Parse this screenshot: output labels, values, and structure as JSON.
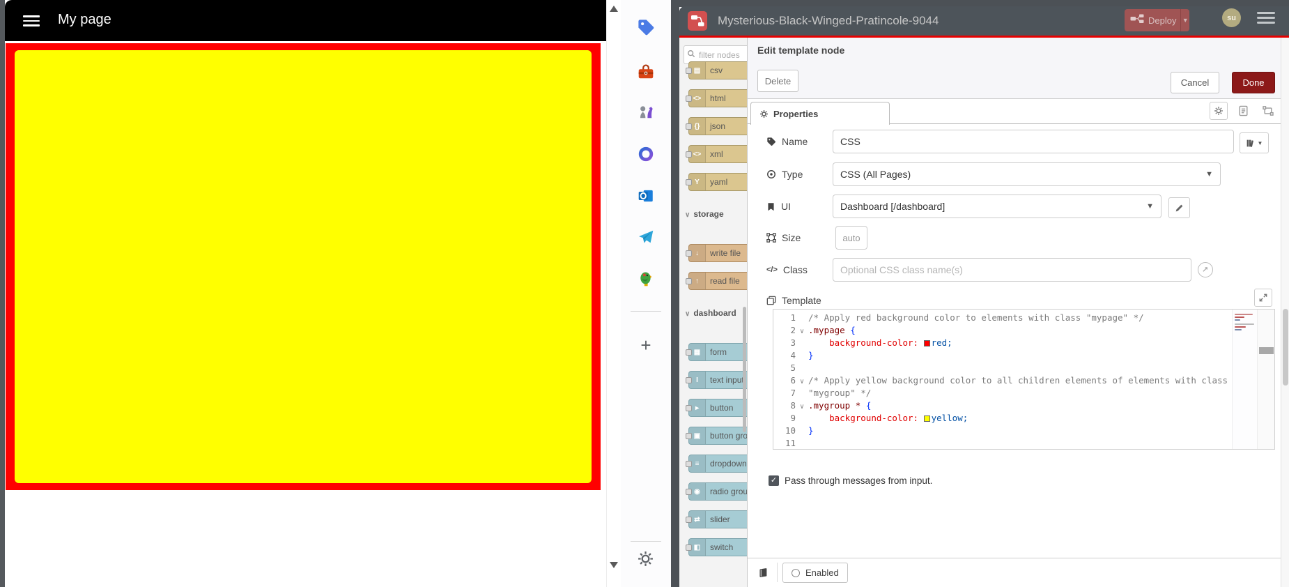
{
  "dashboard_page": {
    "title": "My page",
    "colors": {
      "header_bg": "#000000",
      "mypage_red": "#ff0000",
      "mygroup_yellow": "#ffff00"
    }
  },
  "edge_sidebar": {
    "icons": [
      "tag",
      "toolbox",
      "chess",
      "loop",
      "outlook",
      "telegram",
      "parrot"
    ],
    "plus": "+"
  },
  "node_red": {
    "header": {
      "title": "Mysterious-Black-Winged-Pratincole-9044",
      "deploy_label": "Deploy",
      "avatar": "su",
      "colors": {
        "bar": "#4d545a",
        "accent_line": "#e60000",
        "deploy_bg": "#a05454"
      }
    },
    "palette": {
      "search_placeholder": "filter nodes",
      "items": [
        {
          "type": "node",
          "kind": "parser",
          "glyph": "▤",
          "label": "csv"
        },
        {
          "type": "node",
          "kind": "parser",
          "glyph": "<>",
          "label": "html"
        },
        {
          "type": "node",
          "kind": "parser",
          "glyph": "{}",
          "label": "json"
        },
        {
          "type": "node",
          "kind": "parser",
          "glyph": "<>",
          "label": "xml"
        },
        {
          "type": "node",
          "kind": "parser",
          "glyph": "Y",
          "label": "yaml"
        },
        {
          "type": "header",
          "label": "storage"
        },
        {
          "type": "node",
          "kind": "file",
          "glyph": "↓",
          "label": "write file"
        },
        {
          "type": "node",
          "kind": "file",
          "glyph": "↑",
          "label": "read file"
        },
        {
          "type": "header",
          "label": "dashboard"
        },
        {
          "type": "node",
          "kind": "ui",
          "glyph": "▦",
          "label": "form"
        },
        {
          "type": "node",
          "kind": "ui",
          "glyph": "I",
          "label": "text input"
        },
        {
          "type": "node",
          "kind": "ui",
          "glyph": "▸",
          "label": "button"
        },
        {
          "type": "node",
          "kind": "ui",
          "glyph": "▣",
          "label": "button group"
        },
        {
          "type": "node",
          "kind": "ui",
          "glyph": "≡",
          "label": "dropdown"
        },
        {
          "type": "node",
          "kind": "ui",
          "glyph": "◉",
          "label": "radio group"
        },
        {
          "type": "node",
          "kind": "ui",
          "glyph": "⇄",
          "label": "slider"
        },
        {
          "type": "node",
          "kind": "ui",
          "glyph": "◧",
          "label": "switch"
        }
      ]
    },
    "dialog": {
      "title": "Edit template node",
      "delete_label": "Delete",
      "cancel_label": "Cancel",
      "done_label": "Done",
      "tab_label": "Properties",
      "name": {
        "label": "Name",
        "value": "CSS"
      },
      "type": {
        "label": "Type",
        "value": "CSS (All Pages)"
      },
      "ui": {
        "label": "UI",
        "value": "Dashboard [/dashboard]"
      },
      "size": {
        "label": "Size",
        "value": "auto"
      },
      "class": {
        "label": "Class",
        "placeholder": "Optional CSS class name(s)"
      },
      "template": {
        "label": "Template"
      },
      "passthrough_label": "Pass through messages from input.",
      "enabled_label": "Enabled",
      "done_color": "#8c1919",
      "editor": {
        "lines": [
          {
            "n": 1,
            "fold": false,
            "tokens": [
              [
                "cmt",
                "/* Apply red background color to elements with class \"mypage\" */"
              ]
            ]
          },
          {
            "n": 2,
            "fold": true,
            "tokens": [
              [
                "sel-t",
                ".mypage"
              ],
              [
                "pln",
                " "
              ],
              [
                "brc",
                "{"
              ]
            ]
          },
          {
            "n": 3,
            "fold": false,
            "tokens": [
              [
                "pln",
                "    "
              ],
              [
                "prp",
                "background-color:"
              ],
              [
                "pln",
                " "
              ],
              [
                "swr",
                ""
              ],
              [
                "val",
                "red;"
              ]
            ]
          },
          {
            "n": 4,
            "fold": false,
            "tokens": [
              [
                "brc",
                "}"
              ]
            ]
          },
          {
            "n": 5,
            "fold": false,
            "tokens": []
          },
          {
            "n": 6,
            "fold": true,
            "tokens": [
              [
                "cmt",
                "/* Apply yellow background color to all children elements of elements with class"
              ]
            ]
          },
          {
            "n": 7,
            "fold": false,
            "tokens": [
              [
                "cmt",
                "\"mygroup\" */"
              ]
            ]
          },
          {
            "n": 8,
            "fold": true,
            "tokens": [
              [
                "sel-t",
                ".mygroup"
              ],
              [
                "pln",
                " "
              ],
              [
                "sel-t",
                "*"
              ],
              [
                "pln",
                " "
              ],
              [
                "brc",
                "{"
              ]
            ]
          },
          {
            "n": 9,
            "fold": false,
            "tokens": [
              [
                "pln",
                "    "
              ],
              [
                "prp",
                "background-color:"
              ],
              [
                "pln",
                " "
              ],
              [
                "swy",
                ""
              ],
              [
                "val",
                "yellow;"
              ]
            ]
          },
          {
            "n": 10,
            "fold": false,
            "tokens": [
              [
                "brc",
                "}"
              ]
            ]
          },
          {
            "n": 11,
            "fold": false,
            "tokens": []
          }
        ]
      }
    }
  }
}
